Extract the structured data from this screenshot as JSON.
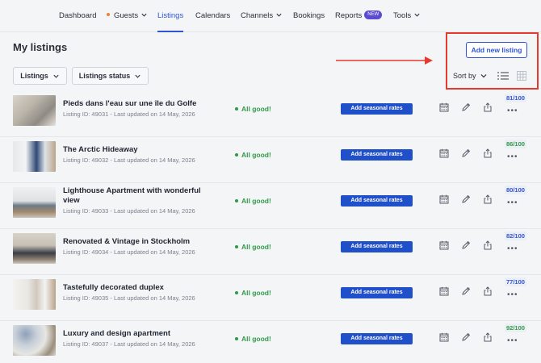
{
  "nav": {
    "items": [
      {
        "label": "Dashboard"
      },
      {
        "label": "Guests"
      },
      {
        "label": "Listings"
      },
      {
        "label": "Calendars"
      },
      {
        "label": "Channels"
      },
      {
        "label": "Bookings"
      },
      {
        "label": "Reports"
      },
      {
        "label": "Tools"
      }
    ],
    "active": "Listings",
    "new_badge": "NEW"
  },
  "header": {
    "title": "My listings",
    "filters": [
      "Listings",
      "Listings status"
    ],
    "add_button": "Add new listing",
    "sort_label": "Sort by"
  },
  "colors": {
    "accent": "#2f55d4",
    "primary_button": "#1f4fc9",
    "success": "#2e9a47",
    "highlight": "#e53a2f",
    "new_badge": "#5a4bd1"
  },
  "listings": [
    {
      "title": "Pieds dans l'eau sur une île du Golfe",
      "meta": "Listing ID: 49031 - Last updated on 14 May, 2026",
      "status": "All good!",
      "action": "Add seasonal rates",
      "score": "81/100",
      "score_color": "#2f55d4"
    },
    {
      "title": "The Arctic Hideaway",
      "meta": "Listing ID: 49032 - Last updated on 14 May, 2026",
      "status": "All good!",
      "action": "Add seasonal rates",
      "score": "86/100",
      "score_color": "#2e9a47"
    },
    {
      "title": "Lighthouse Apartment with wonderful view",
      "meta": "Listing ID: 49033 - Last updated on 14 May, 2026",
      "status": "All good!",
      "action": "Add seasonal rates",
      "score": "80/100",
      "score_color": "#2f55d4"
    },
    {
      "title": "Renovated & Vintage in Stockholm",
      "meta": "Listing ID: 49034 - Last updated on 14 May, 2026",
      "status": "All good!",
      "action": "Add seasonal rates",
      "score": "82/100",
      "score_color": "#2f55d4"
    },
    {
      "title": "Tastefully decorated duplex",
      "meta": "Listing ID: 49035 - Last updated on 14 May, 2026",
      "status": "All good!",
      "action": "Add seasonal rates",
      "score": "77/100",
      "score_color": "#2f55d4"
    },
    {
      "title": "Luxury and design apartment",
      "meta": "Listing ID: 49037 - Last updated on 14 May, 2026",
      "status": "All good!",
      "action": "Add seasonal rates",
      "score": "92/100",
      "score_color": "#2e9a47"
    }
  ]
}
